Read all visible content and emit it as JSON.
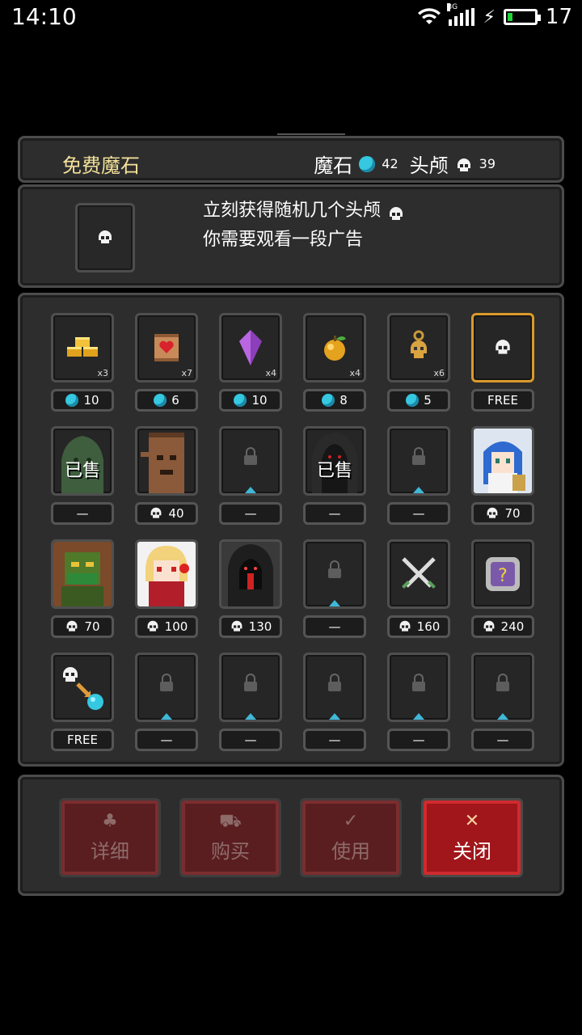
{
  "status_bar": {
    "time": "14:10",
    "network": "3G",
    "battery": "17",
    "battery_level": 0.17,
    "charging_icon": "lightning-icon",
    "wifi_icon": "wifi-icon"
  },
  "header": {
    "title": "免费魔石",
    "gem_label": "魔石",
    "gem_count": "42",
    "skull_label": "头颅",
    "skull_count": "39"
  },
  "info": {
    "line1": "立刻获得随机几个头颅",
    "line2": "你需要观看一段广告"
  },
  "items": [
    {
      "name": "gold-bars",
      "count": "x3",
      "price": "10",
      "currency": "gem"
    },
    {
      "name": "heart-scroll",
      "count": "x7",
      "price": "6",
      "currency": "gem"
    },
    {
      "name": "purple-crystal",
      "count": "x4",
      "price": "10",
      "currency": "gem"
    },
    {
      "name": "golden-apple",
      "count": "x4",
      "price": "8",
      "currency": "gem"
    },
    {
      "name": "skull-key",
      "count": "x6",
      "price": "5",
      "currency": "gem"
    },
    {
      "name": "free-skull",
      "count": "",
      "price": "FREE",
      "currency": "none",
      "selected": true
    },
    {
      "name": "green-slime",
      "sold": "已售",
      "price": "—",
      "currency": "none"
    },
    {
      "name": "tree-monster",
      "price": "40",
      "currency": "skull"
    },
    {
      "name": "locked",
      "price": "—",
      "currency": "none",
      "locked": true
    },
    {
      "name": "dark-wraith",
      "sold": "已售",
      "price": "—",
      "currency": "none"
    },
    {
      "name": "locked",
      "price": "—",
      "currency": "none",
      "locked": true
    },
    {
      "name": "blue-mage-girl",
      "price": "70",
      "currency": "skull"
    },
    {
      "name": "green-ogre",
      "price": "70",
      "currency": "skull"
    },
    {
      "name": "blonde-vampire",
      "price": "100",
      "currency": "skull"
    },
    {
      "name": "hooded-reaper",
      "price": "130",
      "currency": "skull"
    },
    {
      "name": "locked",
      "price": "—",
      "currency": "none",
      "locked": true
    },
    {
      "name": "crossed-swords",
      "price": "160",
      "currency": "skull"
    },
    {
      "name": "mystery-box",
      "price": "240",
      "currency": "skull"
    },
    {
      "name": "skull-to-gem",
      "price": "FREE",
      "currency": "none"
    },
    {
      "name": "locked",
      "price": "—",
      "currency": "none",
      "locked": true
    },
    {
      "name": "locked",
      "price": "—",
      "currency": "none",
      "locked": true
    },
    {
      "name": "locked",
      "price": "—",
      "currency": "none",
      "locked": true
    },
    {
      "name": "locked",
      "price": "—",
      "currency": "none",
      "locked": true
    },
    {
      "name": "locked",
      "price": "—",
      "currency": "none",
      "locked": true
    }
  ],
  "buttons": [
    {
      "label": "详细",
      "icon": "pouch-icon",
      "active": false
    },
    {
      "label": "购买",
      "icon": "cart-icon",
      "active": false
    },
    {
      "label": "使用",
      "icon": "check-icon",
      "active": false
    },
    {
      "label": "关闭",
      "icon": "close-icon",
      "active": true
    }
  ],
  "colors": {
    "gem": "#35c8e0",
    "title": "#f4e29a",
    "selected_border": "#d99a2b",
    "button_active": "#a0161a",
    "button_inactive": "#5a1e20"
  }
}
